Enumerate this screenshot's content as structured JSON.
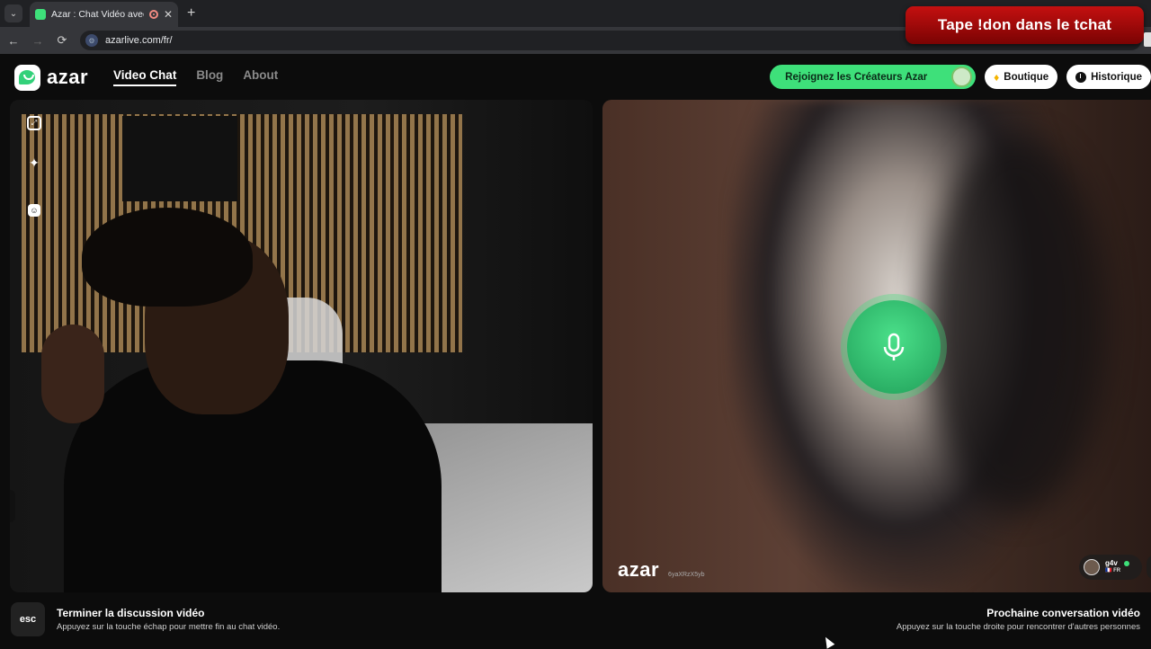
{
  "browser": {
    "tab_title": "Azar : Chat Vidéo avec de n",
    "tab_close": "✕",
    "new_tab": "+",
    "url": "azarlive.com/fr/",
    "back": "←",
    "forward": "→",
    "reload": "⟳",
    "tab_menu": "⌄"
  },
  "overlay": {
    "banner_text": "Tape !don dans le tchat"
  },
  "header": {
    "logo_text": "azar",
    "nav": [
      {
        "label": "Video Chat",
        "active": true
      },
      {
        "label": "Blog",
        "active": false
      },
      {
        "label": "About",
        "active": false
      }
    ],
    "creators_button": "Rejoignez les Créateurs Azar",
    "shop_button": "Boutique",
    "history_button": "Historique"
  },
  "left_panel": {
    "tools": [
      "expand-icon",
      "sparkle-icon",
      "smile-icon"
    ]
  },
  "right_panel": {
    "watermark_logo": "azar",
    "watermark_id": "6yaXRzX5yb",
    "partner_name": "g4v",
    "partner_country": "🇫🇷 FR"
  },
  "footer": {
    "esc_key": "esc",
    "end_title": "Terminer la discussion vidéo",
    "end_sub": "Appuyez sur la touche échap pour mettre fin au chat vidéo.",
    "next_title": "Prochaine conversation vidéo",
    "next_sub": "Appuyez sur la touche droite pour rencontrer d'autres personnes"
  },
  "colors": {
    "accent_green": "#3ee07a",
    "banner_red": "#c41010"
  }
}
